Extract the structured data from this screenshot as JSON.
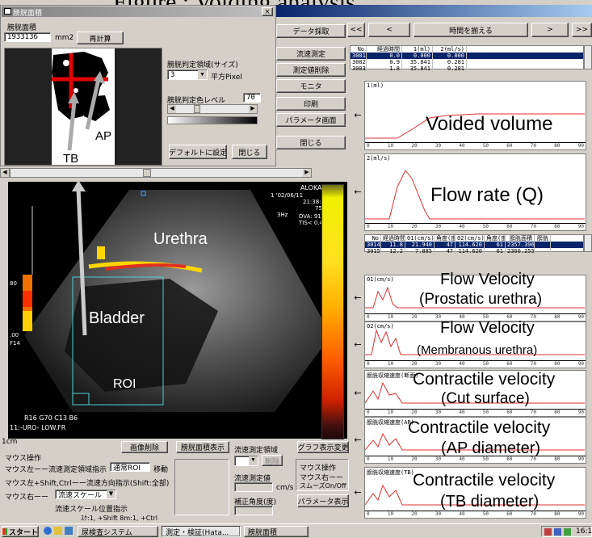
{
  "slide_title": "Figure : Voiding analysis",
  "dialog": {
    "title": "膀胱面積",
    "area_label": "膀胱面積",
    "area_value": "1933136",
    "area_unit": "mm2",
    "recalc_button": "再計算",
    "size_label": "膀胱判定領域(サイズ)",
    "size_value": "3",
    "size_unit": "平方Pixel",
    "color_level_label": "膀胱判定色レベル",
    "color_level_value": "70",
    "default_button": "デフォルトに設定",
    "close_button": "閉じる",
    "close_x": "×"
  },
  "annotations": {
    "ap": "AP",
    "tb": "TB",
    "urethra": "Urethra",
    "bladder": "Bladder",
    "roi": "ROI",
    "voided_volume": "Voided volume",
    "flow_rate": "Flow rate (Q)",
    "flow_vel_prost_1": "Flow Velocity",
    "flow_vel_prost_2": "(Prostatic urethra)",
    "flow_vel_memb_1": "Flow Velocity",
    "flow_vel_memb_2": "(Membranous urethra)",
    "cv_cut_1": "Contractile velocity",
    "cv_cut_2": "(Cut surface)",
    "cv_ap_1": "Contractile velocity",
    "cv_ap_2": "(AP diameter)",
    "cv_tb_1": "Contractile velocity",
    "cv_tb_2": "(TB diameter)"
  },
  "us_overlay": {
    "brand": "ALOKA",
    "line1": "1 '02/06/11",
    "line2": "21:38:49",
    "line3": "75",
    "mode": "3Hz",
    "dva": "DVA: 91%",
    "tis": "TIS< 0.4",
    "bottom1": "R16 G70 C13 B6",
    "bottom2": "11:-URO-  LOW.FR",
    "scale_top": "80",
    "scale_bottom": ".00",
    "scale_f": "F14",
    "cm": "1cm"
  },
  "middle_buttons": [
    "データ採取",
    "流速測定",
    "測定値削除",
    "モニタ",
    "印刷",
    "パラメータ画面",
    "閉じる"
  ],
  "nav": {
    "first": "<<",
    "prev": "<",
    "time": "時間を揃える",
    "next": ">",
    "last": ">>"
  },
  "table1": {
    "headers": [
      "No",
      "経過時間",
      "1(ml)",
      "2(ml/s)"
    ],
    "rows": [
      [
        "3001",
        "0.0",
        "0.000",
        "0.000"
      ],
      [
        "3002",
        "0.9",
        "35.841",
        "0.281"
      ],
      [
        "3003",
        "1.8",
        "35.841",
        "0.281"
      ]
    ]
  },
  "table2": {
    "headers": [
      "No",
      "経過時間",
      "01(cm/s)",
      "角度(度)",
      "02(cm/s)",
      "角度(度)",
      "膀胱面積",
      "膀胱"
    ],
    "rows": [
      [
        "3014",
        "11.8",
        "21.940",
        "47",
        "114.620",
        "61",
        "2357.396",
        ""
      ],
      [
        "3015",
        "12.2",
        "7.885",
        "47",
        "114.620",
        "61",
        "2360.255",
        ""
      ]
    ]
  },
  "plots": [
    {
      "label": "1(ml)"
    },
    {
      "label": "2(ml/s)"
    },
    {
      "label": "01(cm/s)"
    },
    {
      "label": "02(cm/s)"
    },
    {
      "label": "膀胱収縮速度(断面)"
    },
    {
      "label": "膀胱収縮速度(AP)"
    },
    {
      "label": "膀胱収縮速度(TB)"
    }
  ],
  "axis_ticks": [
    "0",
    "10",
    "20",
    "30",
    "40",
    "50",
    "60",
    "70",
    "80",
    "90"
  ],
  "bottom_panel": {
    "image_delete": "画像削除",
    "bladder_area_show": "膀胱面積表示",
    "flow_region": "流速測定領域",
    "delete_small": "削除",
    "graph_toggle": "グラフ表示変更",
    "mouse_ops": "マウス操作",
    "op1": "マウス左ーー流速測定領域指示",
    "op1_value": "通常ROI",
    "op1_suffix": "移動",
    "op2": "マウス左+Shift,Ctrlーー流速方向指示(Shift:全部)",
    "op3": "マウス右ーー",
    "op3_value": "流速スケール",
    "scale_pos": "流速スケール位置指示",
    "scale_hint": "ｽｸ:1, +Shift 8m:1, +Ctrl",
    "flow_value_label": "流速測定値",
    "flow_unit": "cm/s",
    "angle_label": "補正角度(度)",
    "mouse_op_box1": "マウス操作",
    "mouse_op_box2": "マウス右ーー",
    "mouse_op_box3": "スムーズOn/Off",
    "param_show": "パラメータ表示"
  },
  "taskbar": {
    "start": "スタート",
    "items": [
      "尿検査システム",
      "測定・検証(Hata...",
      "膀胱面積"
    ],
    "clock": "16:1"
  }
}
